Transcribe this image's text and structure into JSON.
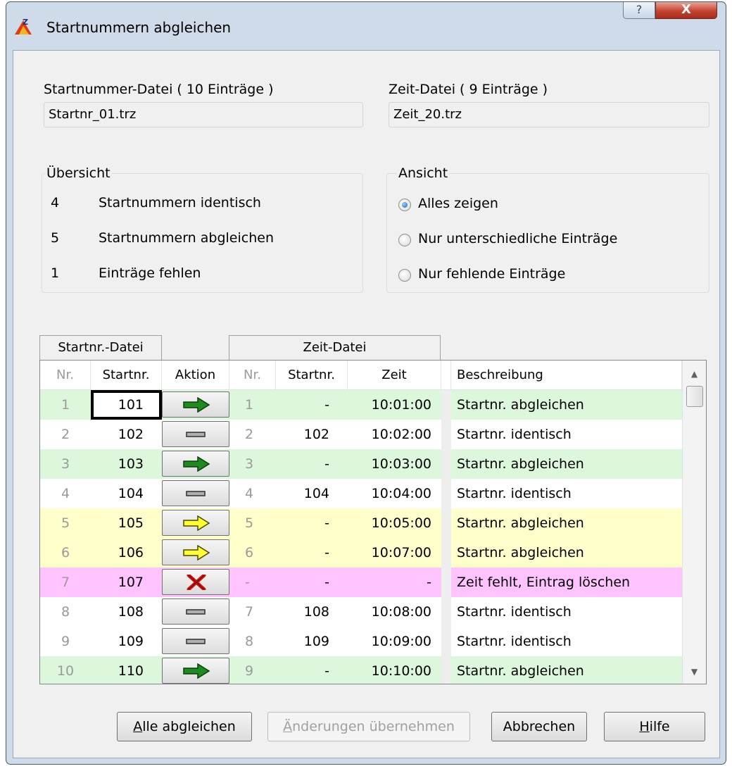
{
  "window": {
    "title": "Startnummern abgleichen",
    "help_label": "?",
    "close_label": "X"
  },
  "files": {
    "startnr_label": "Startnummer-Datei ( 10 Einträge )",
    "startnr_value": "Startnr_01.trz",
    "zeit_label": "Zeit-Datei ( 9 Einträge )",
    "zeit_value": "Zeit_20.trz"
  },
  "overview": {
    "title": "Übersicht",
    "items": [
      {
        "count": "4",
        "label": "Startnummern identisch"
      },
      {
        "count": "5",
        "label": "Startnummern abgleichen"
      },
      {
        "count": "1",
        "label": "Einträge fehlen"
      }
    ]
  },
  "view": {
    "title": "Ansicht",
    "options": [
      {
        "label": "Alles zeigen",
        "checked": true
      },
      {
        "label": "Nur unterschiedliche Einträge",
        "checked": false
      },
      {
        "label": "Nur fehlende Einträge",
        "checked": false
      }
    ]
  },
  "table": {
    "group_startnr": "Startnr.-Datei",
    "group_zeit": "Zeit-Datei",
    "headers": {
      "nr": "Nr.",
      "startnr": "Startnr.",
      "aktion": "Aktion",
      "nr2": "Nr.",
      "startnr2": "Startnr.",
      "zeit": "Zeit",
      "beschreibung": "Beschreibung"
    },
    "rows": [
      {
        "nr": "1",
        "startnr": "101",
        "action": "arrow-green",
        "nr2": "1",
        "startnr2": "-",
        "zeit": "10:01:00",
        "desc": "Startnr. abgleichen",
        "color": "#ddf7dd"
      },
      {
        "nr": "2",
        "startnr": "102",
        "action": "equal",
        "nr2": "2",
        "startnr2": "102",
        "zeit": "10:02:00",
        "desc": "Startnr. identisch",
        "color": "#ffffff"
      },
      {
        "nr": "3",
        "startnr": "103",
        "action": "arrow-green",
        "nr2": "3",
        "startnr2": "-",
        "zeit": "10:03:00",
        "desc": "Startnr. abgleichen",
        "color": "#ddf7dd"
      },
      {
        "nr": "4",
        "startnr": "104",
        "action": "equal",
        "nr2": "4",
        "startnr2": "104",
        "zeit": "10:04:00",
        "desc": "Startnr. identisch",
        "color": "#ffffff"
      },
      {
        "nr": "5",
        "startnr": "105",
        "action": "arrow-yellow",
        "nr2": "5",
        "startnr2": "-",
        "zeit": "10:05:00",
        "desc": "Startnr. abgleichen",
        "color": "#ffffcc"
      },
      {
        "nr": "6",
        "startnr": "106",
        "action": "arrow-yellow",
        "nr2": "6",
        "startnr2": "-",
        "zeit": "10:07:00",
        "desc": "Startnr. abgleichen",
        "color": "#ffffcc"
      },
      {
        "nr": "7",
        "startnr": "107",
        "action": "cross-red",
        "nr2": "-",
        "startnr2": "-",
        "zeit": "-",
        "desc": "Zeit fehlt, Eintrag löschen",
        "color": "#ffc4ff"
      },
      {
        "nr": "8",
        "startnr": "108",
        "action": "equal",
        "nr2": "7",
        "startnr2": "108",
        "zeit": "10:08:00",
        "desc": "Startnr. identisch",
        "color": "#ffffff"
      },
      {
        "nr": "9",
        "startnr": "109",
        "action": "equal",
        "nr2": "8",
        "startnr2": "109",
        "zeit": "10:09:00",
        "desc": "Startnr. identisch",
        "color": "#ffffff"
      },
      {
        "nr": "10",
        "startnr": "110",
        "action": "arrow-green",
        "nr2": "9",
        "startnr2": "-",
        "zeit": "10:10:00",
        "desc": "Startnr. abgleichen",
        "color": "#ddf7dd"
      }
    ]
  },
  "buttons": {
    "alle_key": "A",
    "alle_rest": "lle abgleichen",
    "aenderungen_key": "Ä",
    "aenderungen_rest": "nderungen übernehmen",
    "abbrechen": "Abbrechen",
    "hilfe_key": "H",
    "hilfe_rest": "ilfe"
  },
  "colors": {
    "green_row": "#ddf7dd",
    "yellow_row": "#ffffcc",
    "pink_row": "#ffc4ff",
    "arrow_green": "#1f8a1f",
    "arrow_yellow": "#ffff33",
    "cross_red": "#d01010"
  }
}
